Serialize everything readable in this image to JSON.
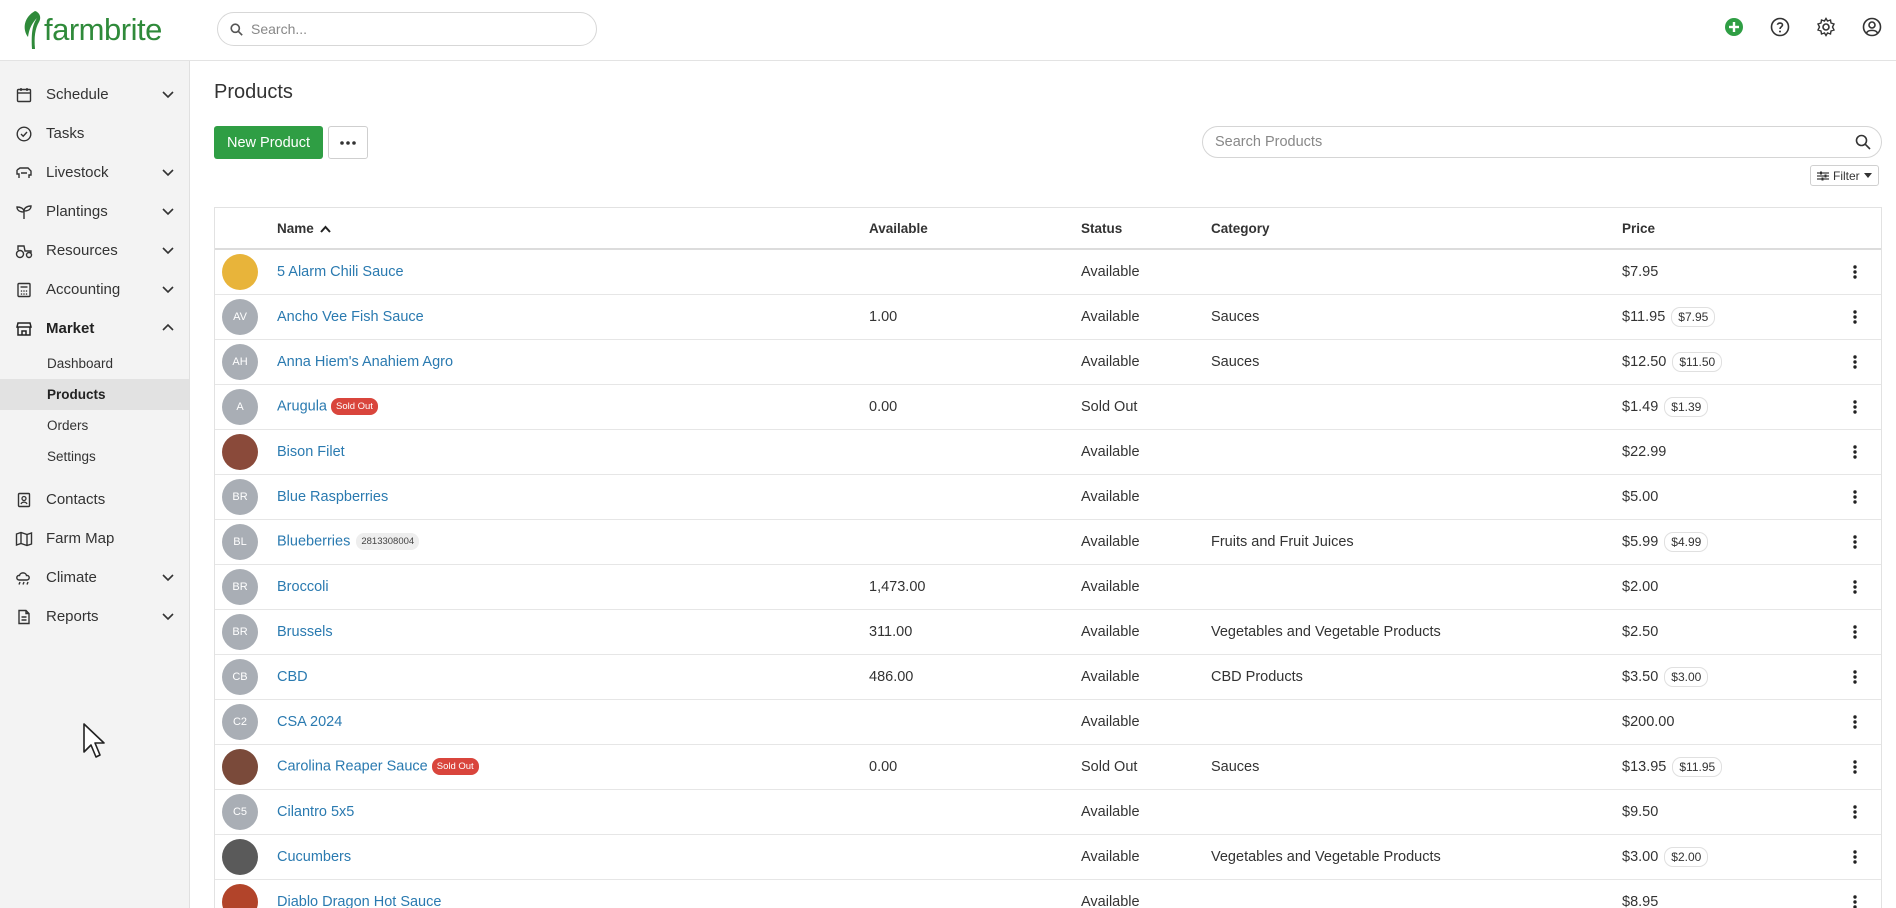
{
  "app": {
    "brand": "farmbrite",
    "brand_color": "#2f8a3a",
    "accent": "#2f9e44"
  },
  "header": {
    "search_placeholder": "Search...",
    "icons": [
      "add-icon",
      "help-icon",
      "settings-icon",
      "user-icon"
    ]
  },
  "sidebar": {
    "items": [
      {
        "label": "Schedule",
        "icon": "calendar-icon",
        "chevron": "down"
      },
      {
        "label": "Tasks",
        "icon": "check-circle-icon"
      },
      {
        "label": "Livestock",
        "icon": "livestock-icon",
        "chevron": "down"
      },
      {
        "label": "Plantings",
        "icon": "sprout-icon",
        "chevron": "down"
      },
      {
        "label": "Resources",
        "icon": "tractor-icon",
        "chevron": "down"
      },
      {
        "label": "Accounting",
        "icon": "calculator-icon",
        "chevron": "down"
      },
      {
        "label": "Market",
        "icon": "market-icon",
        "chevron": "up"
      },
      {
        "label": "Contacts",
        "icon": "contacts-icon"
      },
      {
        "label": "Farm Map",
        "icon": "map-icon"
      },
      {
        "label": "Climate",
        "icon": "climate-icon",
        "chevron": "down"
      },
      {
        "label": "Reports",
        "icon": "report-icon",
        "chevron": "down"
      }
    ],
    "market_sub": [
      "Dashboard",
      "Products",
      "Orders",
      "Settings"
    ],
    "selected_sub": "Products"
  },
  "main": {
    "title": "Products",
    "new_button": "New Product",
    "search_placeholder": "Search Products",
    "filter_label": "Filter",
    "columns": {
      "name": "Name",
      "available": "Available",
      "status": "Status",
      "category": "Category",
      "price": "Price"
    },
    "rows": [
      {
        "initials": "",
        "name": "5 Alarm Chili Sauce",
        "badge": "",
        "sku": "",
        "available": "",
        "status": "Available",
        "category": "",
        "price": "$7.95",
        "sale": "",
        "avatar_type": "image",
        "avatar_color": "#e8b43a"
      },
      {
        "initials": "AV",
        "name": "Ancho Vee Fish Sauce",
        "badge": "",
        "sku": "",
        "available": "1.00",
        "status": "Available",
        "category": "Sauces",
        "price": "$11.95",
        "sale": "$7.95"
      },
      {
        "initials": "AH",
        "name": "Anna Hiem's Anahiem Agro",
        "badge": "",
        "sku": "",
        "available": "",
        "status": "Available",
        "category": "Sauces",
        "price": "$12.50",
        "sale": "$11.50"
      },
      {
        "initials": "A",
        "name": "Arugula",
        "badge": "Sold Out",
        "sku": "",
        "available": "0.00",
        "status": "Sold Out",
        "category": "",
        "price": "$1.49",
        "sale": "$1.39"
      },
      {
        "initials": "",
        "name": "Bison Filet",
        "badge": "",
        "sku": "",
        "available": "",
        "status": "Available",
        "category": "",
        "price": "$22.99",
        "sale": "",
        "avatar_type": "image",
        "avatar_color": "#8a4a3a"
      },
      {
        "initials": "BR",
        "name": "Blue Raspberries",
        "badge": "",
        "sku": "",
        "available": "",
        "status": "Available",
        "category": "",
        "price": "$5.00",
        "sale": ""
      },
      {
        "initials": "BL",
        "name": "Blueberries",
        "badge": "",
        "sku": "2813308004",
        "available": "",
        "status": "Available",
        "category": "Fruits and Fruit Juices",
        "price": "$5.99",
        "sale": "$4.99"
      },
      {
        "initials": "BR",
        "name": "Broccoli",
        "badge": "",
        "sku": "",
        "available": "1,473.00",
        "status": "Available",
        "category": "",
        "price": "$2.00",
        "sale": ""
      },
      {
        "initials": "BR",
        "name": "Brussels",
        "badge": "",
        "sku": "",
        "available": "311.00",
        "status": "Available",
        "category": "Vegetables and Vegetable Products",
        "price": "$2.50",
        "sale": ""
      },
      {
        "initials": "CB",
        "name": "CBD",
        "badge": "",
        "sku": "",
        "available": "486.00",
        "status": "Available",
        "category": "CBD Products",
        "price": "$3.50",
        "sale": "$3.00"
      },
      {
        "initials": "C2",
        "name": "CSA 2024",
        "badge": "",
        "sku": "",
        "available": "",
        "status": "Available",
        "category": "",
        "price": "$200.00",
        "sale": ""
      },
      {
        "initials": "",
        "name": "Carolina Reaper Sauce",
        "badge": "Sold Out",
        "sku": "",
        "available": "0.00",
        "status": "Sold Out",
        "category": "Sauces",
        "price": "$13.95",
        "sale": "$11.95",
        "avatar_type": "image",
        "avatar_color": "#7a4a3a"
      },
      {
        "initials": "C5",
        "name": "Cilantro 5x5",
        "badge": "",
        "sku": "",
        "available": "",
        "status": "Available",
        "category": "",
        "price": "$9.50",
        "sale": ""
      },
      {
        "initials": "",
        "name": "Cucumbers",
        "badge": "",
        "sku": "",
        "available": "",
        "status": "Available",
        "category": "Vegetables and Vegetable Products",
        "price": "$3.00",
        "sale": "$2.00",
        "avatar_type": "image",
        "avatar_color": "#5a5a5a"
      },
      {
        "initials": "",
        "name": "Diablo Dragon Hot Sauce",
        "badge": "",
        "sku": "",
        "available": "",
        "status": "Available",
        "category": "",
        "price": "$8.95",
        "sale": "",
        "avatar_type": "image",
        "avatar_color": "#b2442a"
      }
    ]
  }
}
